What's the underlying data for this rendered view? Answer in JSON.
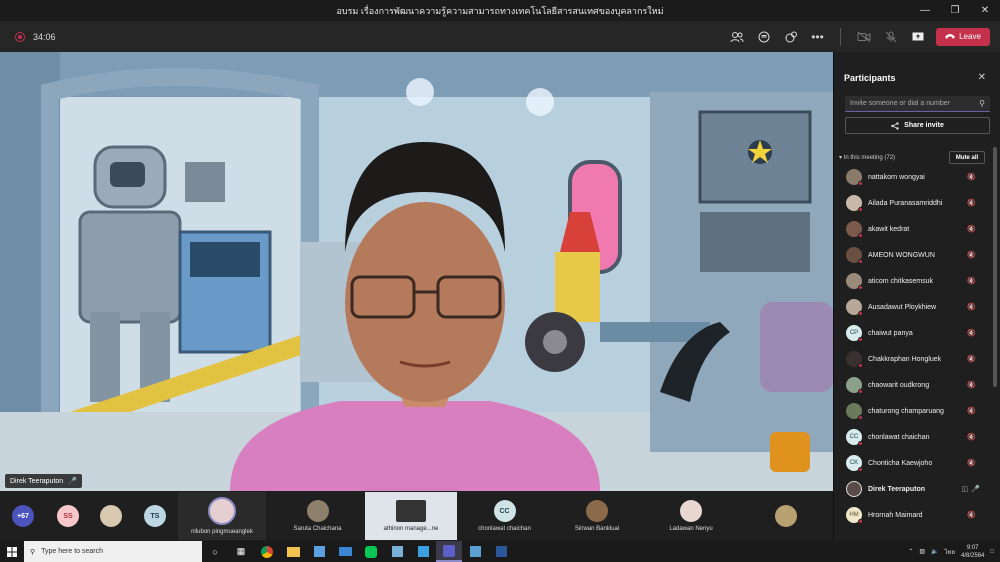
{
  "window": {
    "title": "อบรม เรื่องการพัฒนาความรู้ความสามารถทางเทคโนโลยีสารสนเทศของบุคลากรใหม่"
  },
  "toolbar": {
    "timer": "34:06",
    "leave_label": "Leave"
  },
  "stage": {
    "presenter_name": "Direk Teeraputon"
  },
  "strip": {
    "overflow_count": "+67",
    "initials": [
      "SS",
      "TS"
    ],
    "tiles": [
      {
        "label": "nilubon pingmueanglek"
      },
      {
        "label": "Saruta Chaichana"
      },
      {
        "label": "athinon manage...ne"
      },
      {
        "label": "chonlawat chaichan",
        "initials": "CC"
      },
      {
        "label": "Siriwan Bankluai"
      },
      {
        "label": "Ladawan Nenyu"
      }
    ]
  },
  "panel": {
    "title": "Participants",
    "invite_placeholder": "Invite someone or dial a number",
    "share_invite": "Share invite",
    "in_meeting": "In this meeting (72)",
    "mute_all": "Mute all",
    "participants": [
      {
        "name": "nattakorn wongyai",
        "initials": ""
      },
      {
        "name": "Ailada Puranasamriddhi",
        "initials": ""
      },
      {
        "name": "akawit kedrat",
        "initials": ""
      },
      {
        "name": "AMEON WONGWUN",
        "initials": ""
      },
      {
        "name": "aticom chitkasemsuk",
        "initials": ""
      },
      {
        "name": "Ausadawut Ploykhiew",
        "initials": ""
      },
      {
        "name": "chaiwut panya",
        "initials": "CP"
      },
      {
        "name": "Chakkraphan Hongluek",
        "initials": ""
      },
      {
        "name": "chaowarit oudkrong",
        "initials": ""
      },
      {
        "name": "chaturong champaruang",
        "initials": ""
      },
      {
        "name": "chonlawat chaichan",
        "initials": "CC"
      },
      {
        "name": "Chonticha Kaewjoho",
        "initials": "CK"
      },
      {
        "name": "Direk Teeraputon",
        "initials": ""
      },
      {
        "name": "Hrornah Maimard",
        "initials": "HM"
      }
    ]
  },
  "taskbar": {
    "search_placeholder": "Type here to search",
    "lang": "ไทย",
    "time": "9:07",
    "date": "4/8/2564"
  },
  "colors": {
    "leave": "#c4314b",
    "accent": "#6264a7"
  }
}
